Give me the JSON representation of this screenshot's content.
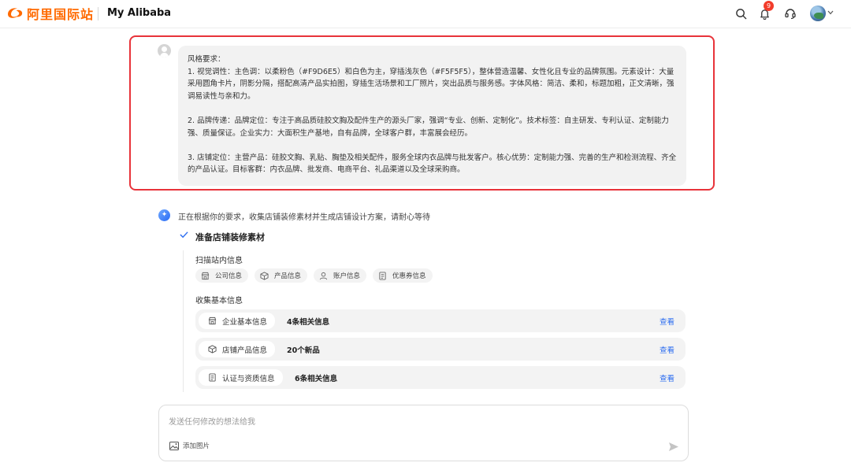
{
  "header": {
    "logo_text": "阿里国际站",
    "app_title": "My Alibaba",
    "notification_count": "9",
    "icons": [
      "search-icon",
      "bell-icon",
      "headset-icon",
      "avatar",
      "chevron-down-icon"
    ]
  },
  "user_message": {
    "lines": [
      "风格要求：",
      "1. 视觉调性：主色调：以柔粉色（#F9D6E5）和白色为主，穿插浅灰色（#F5F5F5），整体营造温馨、女性化且专业的品牌氛围。元素设计：大量采用圆角卡片，阴影分隔，搭配高清产品实拍图，穿插生活场景和工厂照片，突出品质与服务感。字体风格：简洁、柔和，标题加粗，正文清晰，强调易读性与亲和力。",
      "",
      "2. 品牌传递：品牌定位：专注于高品质硅胶文胸及配件生产的源头厂家，强调“专业、创新、定制化”。技术标签：自主研发、专利认证、定制能力强、质量保证。企业实力：大面积生产基地，自有品牌，全球客户群，丰富展会经历。",
      "",
      "3. 店铺定位：主营产品：硅胶文胸、乳贴、胸垫及相关配件，服务全球内衣品牌与批发客户。核心优势：定制能力强、完善的生产和检测流程、齐全的产品认证。目标客群：内衣品牌、批发商、电商平台、礼品渠道以及全球采购商。"
    ]
  },
  "assistant": {
    "status_text": "正在根据你的要求，收集店铺装修素材并生成店铺设计方案，请耐心等待",
    "step_title": "准备店铺装修素材",
    "scan_label": "扫描站内信息",
    "scan_chips": [
      {
        "label": "公司信息",
        "icon": "store-icon"
      },
      {
        "label": "产品信息",
        "icon": "box-icon"
      },
      {
        "label": "账户信息",
        "icon": "user-icon"
      },
      {
        "label": "优惠券信息",
        "icon": "coupon-icon"
      }
    ],
    "collect_label": "收集基本信息",
    "collect_rows": [
      {
        "label": "企业基本信息",
        "count": "4条相关信息",
        "link": "查看",
        "icon": "store-icon"
      },
      {
        "label": "店铺产品信息",
        "count": "20个新品",
        "link": "查看",
        "icon": "box-icon"
      },
      {
        "label": "认证与资质信息",
        "count": "6条相关信息",
        "link": "查看",
        "icon": "document-icon"
      }
    ]
  },
  "composer": {
    "placeholder": "发送任何修改的想法给我",
    "add_image_label": "添加图片"
  },
  "colors": {
    "brand_orange": "#ff6a00",
    "highlight_red": "#e8333a",
    "link_blue": "#2b6cf0",
    "bubble_gray": "#f2f2f2"
  }
}
